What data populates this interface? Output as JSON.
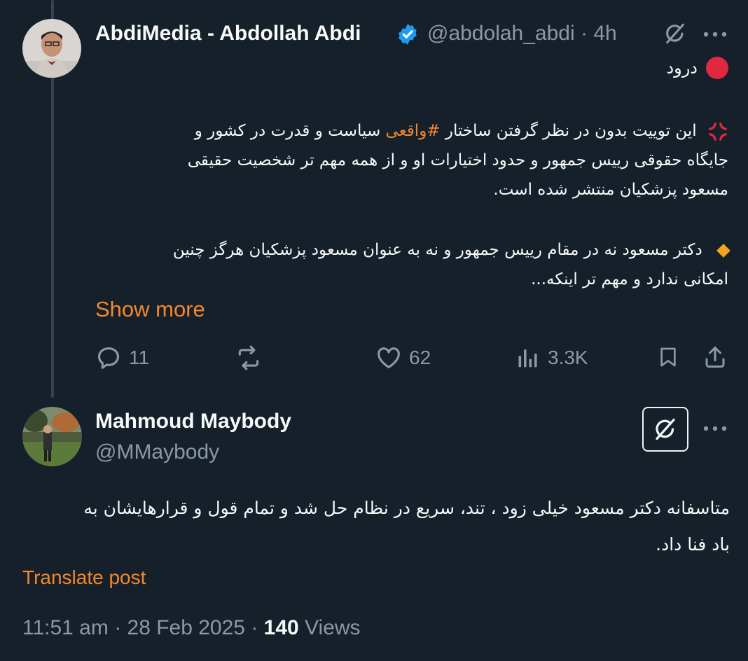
{
  "post": {
    "author_name": "AbdiMedia - Abdollah Abdi",
    "handle": "@abdolah_abdi",
    "time": "4h",
    "status_text": "درود",
    "p1": "این توییت بدون در نظر گرفتن ساختار",
    "hashtag": "#واقعی",
    "p1b": "سیاست و قدرت در کشور و",
    "p1_l2": "جایگاه حقوقی رییس جمهور و حدود اختیارات او و از همه مهم تر شخصیت حقیقی",
    "p1_l3": "مسعود پزشکیان منتشر شده است.",
    "p2_l1": "دکتر مسعود نه در مقام رییس جمهور و نه به عنوان مسعود پزشکیان هرگز چنین",
    "p2_l2": "امکانی ندارد و مهم تر اینکه...",
    "show_more": "Show more",
    "replies": "11",
    "likes": "62",
    "views": "3.3K"
  },
  "reply": {
    "author_name": "Mahmoud Maybody",
    "handle": "@MMaybody",
    "text_l1": "متاسفانه دکتر مسعود خیلی زود ، تند، سریع در نظام حل شد و تمام قول و قرارهایشان به",
    "text_l2": "باد فنا داد.",
    "translate": "Translate post",
    "timestamp": "11:51 am · 28 Feb 2025 · ",
    "views_count": "140",
    "views_label": "Views"
  },
  "colors": {
    "accent": "#f4872c",
    "verified": "#1d9bf0",
    "background": "#15202b"
  }
}
